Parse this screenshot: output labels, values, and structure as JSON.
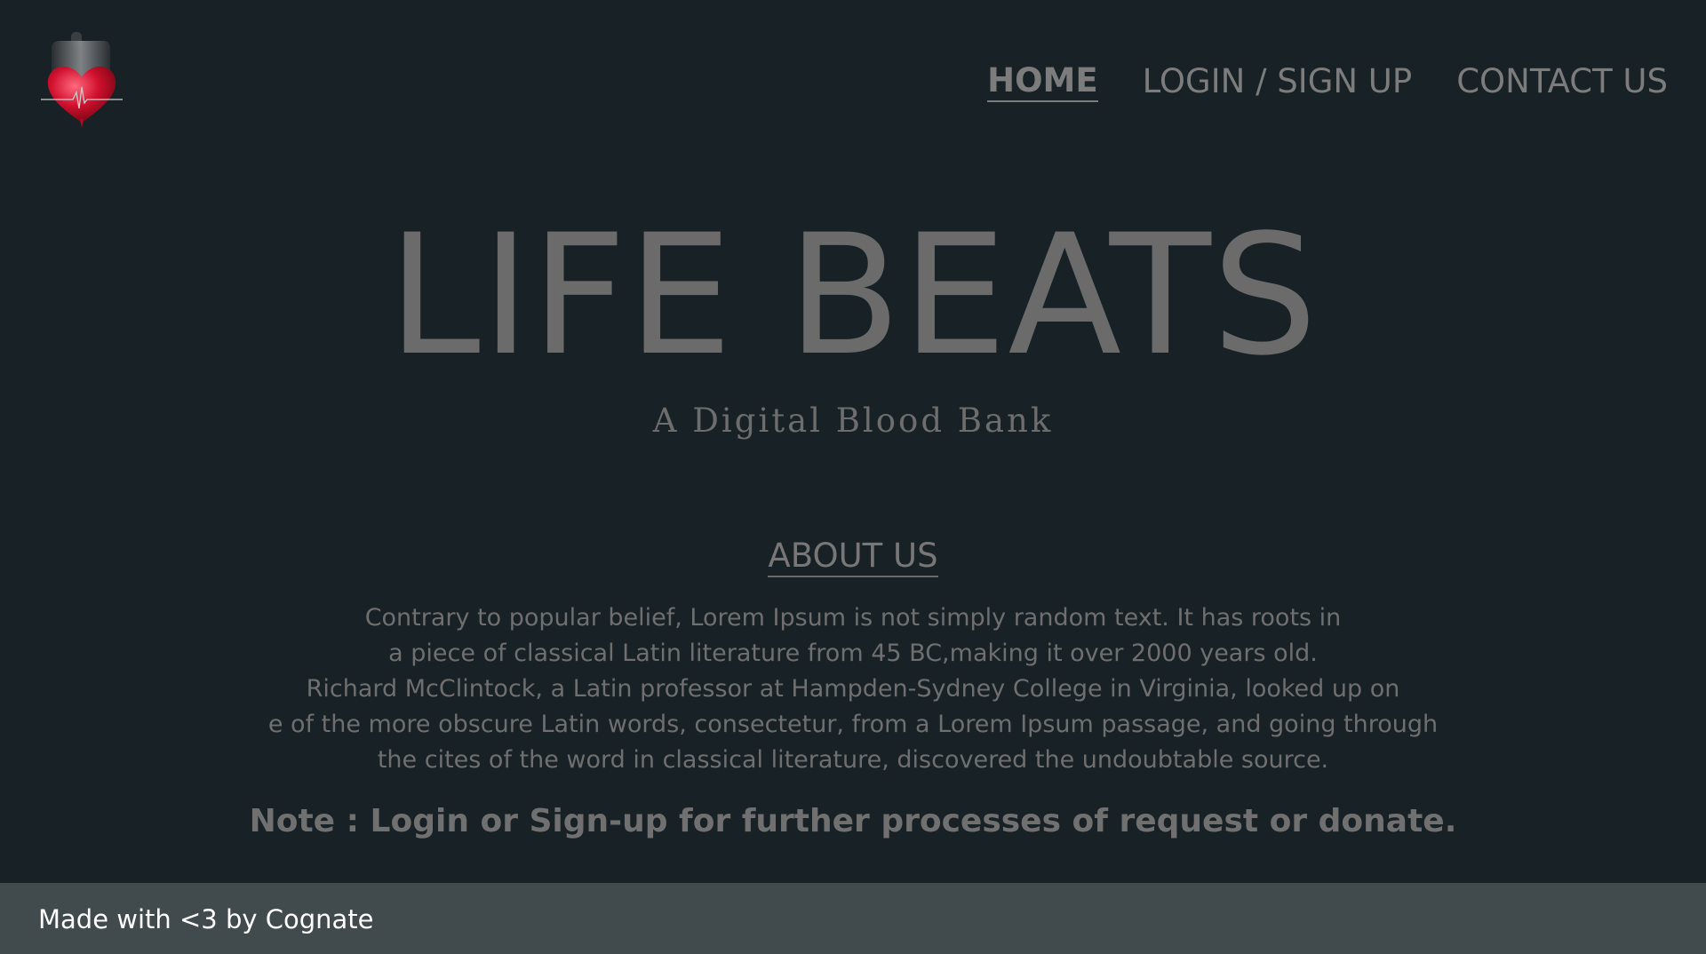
{
  "header": {
    "logo_icon": "blood-bag-heart-icon",
    "nav": [
      {
        "label": "HOME",
        "active": true
      },
      {
        "label": "LOGIN / SIGN UP",
        "active": false
      },
      {
        "label": "CONTACT US",
        "active": false
      }
    ]
  },
  "hero": {
    "title": "LIFE BEATS",
    "subtitle": "A Digital Blood Bank"
  },
  "about": {
    "heading": "ABOUT US",
    "lines": [
      "Contrary to popular belief, Lorem Ipsum is not simply random text. It has roots in",
      "a piece of classical Latin literature from 45 BC,making it over 2000 years old.",
      "Richard McClintock, a Latin professor at Hampden-Sydney College in Virginia, looked up on",
      "e of the more obscure Latin words, consectetur, from a Lorem Ipsum passage, and going through",
      "the cites of the word in classical literature, discovered the undoubtable source."
    ],
    "note": "Note : Login or Sign-up for further processes of request or donate."
  },
  "footer": {
    "text": "Made with <3 by Cognate"
  },
  "colors": {
    "background": "#172126",
    "footer_bg": "#414a4c",
    "logo_red": "#d0102e"
  }
}
